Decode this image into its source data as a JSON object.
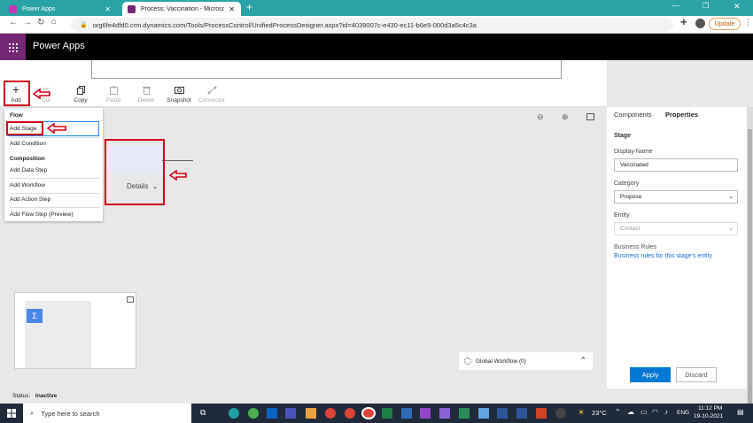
{
  "browser": {
    "tabs": [
      {
        "label": "Power Apps",
        "favicon_color": "#c239b3"
      },
      {
        "label": "Process: Vaccination - Microsoft D",
        "favicon_color": "#742774"
      }
    ],
    "url": "org6fe4dfd0.crm.dynamics.com/Tools/ProcessControl/UnifiedProcessDesigner.aspx?id=4039007c-e430-ec11-b6e5-000d3a5c4c3a",
    "update_label": "Update"
  },
  "app": {
    "title": "Power Apps"
  },
  "toolbar": {
    "add": "Add",
    "cut": "Cut",
    "copy": "Copy",
    "paste": "Paste",
    "delete": "Delete",
    "snapshot": "Snapshot",
    "connector": "Connector"
  },
  "menu": {
    "flow_header": "Flow",
    "add_stage": "Add Stage",
    "add_condition": "Add Condition",
    "composition_header": "Composition",
    "add_data_step": "Add Data Step",
    "add_workflow": "Add Workflow",
    "add_action_step": "Add Action Step",
    "add_flow_step": "Add Flow Step (Preview)"
  },
  "canvas": {
    "details_label": "Details",
    "global_workflow": "Global Workflow (0)"
  },
  "panel": {
    "tab_components": "Components",
    "tab_properties": "Properties",
    "section": "Stage",
    "display_name_label": "Display Name",
    "display_name_value": "Vaccinated",
    "category_label": "Category",
    "category_value": "Propose",
    "entity_label": "Entity",
    "entity_value": "Contact",
    "business_rules_label": "Business Rules",
    "business_rules_link": "Business rules for this stage's entity",
    "apply": "Apply",
    "discard": "Discard"
  },
  "status": {
    "label": "Status:",
    "value": "Inactive"
  },
  "taskbar": {
    "search_placeholder": "Type here to search",
    "temperature": "23°C",
    "lang": "ENG",
    "time": "11:12 PM",
    "date": "19-10-2021"
  },
  "colors": {
    "accent": "#0078d4",
    "brand": "#742774",
    "chrome": "#2aa3a6",
    "highlight": "#d0021b"
  }
}
